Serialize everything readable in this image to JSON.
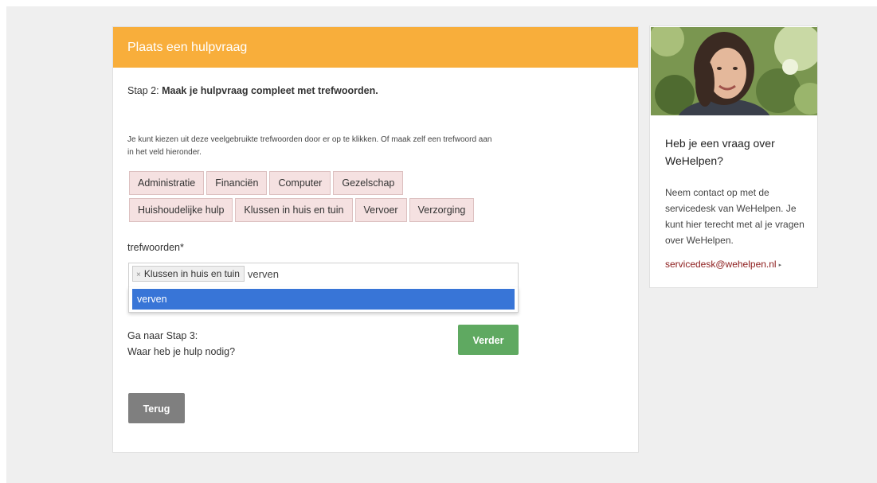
{
  "form": {
    "header_title": "Plaats een hulpvraag",
    "step_prefix": "Stap 2:",
    "step_title": "Maak je hulpvraag compleet met trefwoorden.",
    "intro_text": "Je kunt kiezen uit deze veelgebruikte trefwoorden door er op te klikken. Of maak zelf een trefwoord aan in het veld hieronder.",
    "suggested_tags": [
      "Administratie",
      "Financiën",
      "Computer",
      "Gezelschap",
      "Huishoudelijke hulp",
      "Klussen in huis en tuin",
      "Vervoer",
      "Verzorging"
    ],
    "field_label": "trefwoorden*",
    "selected_tags": [
      "Klussen in huis en tuin"
    ],
    "remove_icon": "×",
    "input_value": "verven",
    "dropdown_options": [
      "verven"
    ],
    "next_line1": "Ga naar Stap 3:",
    "next_line2": "Waar heb je hulp nodig?",
    "next_button": "Verder",
    "back_button": "Terug"
  },
  "sidebar": {
    "title": "Heb je een vraag over WeHelpen?",
    "text": "Neem contact op met de servicedesk van WeHelpen. Je kunt hier terecht met al je vragen over WeHelpen.",
    "link": "servicedesk@wehelpen.nl",
    "link_arrow_icon": "▸"
  },
  "colors": {
    "header": "#f8ae3b",
    "tag_bg": "#f5e1e1",
    "highlight": "#3875d7",
    "next_button": "#5fa961",
    "back_button": "#7f7f7f",
    "link": "#8b1a1a"
  }
}
